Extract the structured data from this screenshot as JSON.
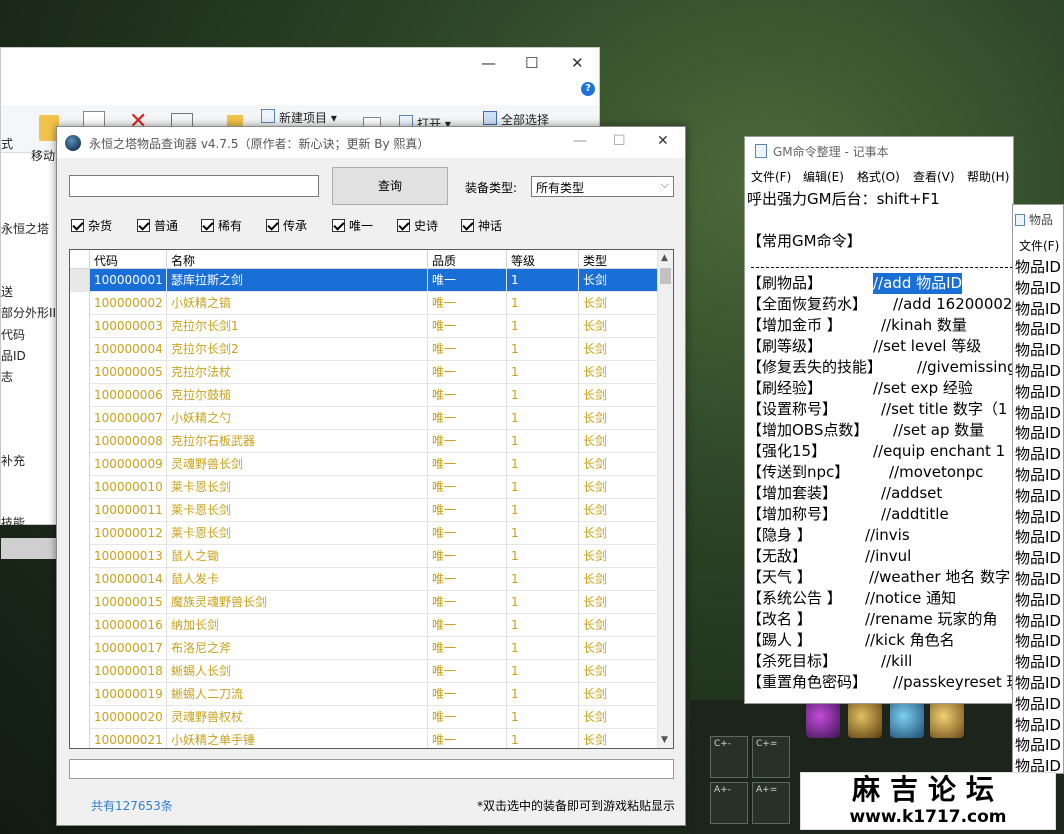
{
  "explorer": {
    "ribbon": {
      "new_item": "新建项目 ▾",
      "open": "打开 ▾",
      "select_all": "全部选择",
      "move": "移动",
      "partial_left": "式"
    },
    "nav_items": [
      "永恒之塔",
      "送",
      "部分外形II",
      "代码",
      "品ID",
      "志",
      "补充",
      "技能"
    ]
  },
  "query": {
    "title": "永恒之塔物品查询器 v4.7.5（原作者：新心诀；更新 By 熙真）",
    "search_value": "",
    "search_button": "查询",
    "type_label": "装备类型:",
    "type_value": "所有类型",
    "checkboxes": [
      "杂货",
      "普通",
      "稀有",
      "传承",
      "唯一",
      "史诗",
      "神话"
    ],
    "columns": [
      "代码",
      "名称",
      "品质",
      "等级",
      "类型"
    ],
    "rows": [
      [
        "100000001",
        "瑟库拉斯之剑",
        "唯一",
        "1",
        "长剑"
      ],
      [
        "100000002",
        "小妖精之镐",
        "唯一",
        "1",
        "长剑"
      ],
      [
        "100000003",
        "克拉尔长剑1",
        "唯一",
        "1",
        "长剑"
      ],
      [
        "100000004",
        "克拉尔长剑2",
        "唯一",
        "1",
        "长剑"
      ],
      [
        "100000005",
        "克拉尔法杖",
        "唯一",
        "1",
        "长剑"
      ],
      [
        "100000006",
        "克拉尔鼓槌",
        "唯一",
        "1",
        "长剑"
      ],
      [
        "100000007",
        "小妖精之勺",
        "唯一",
        "1",
        "长剑"
      ],
      [
        "100000008",
        "克拉尔石板武器",
        "唯一",
        "1",
        "长剑"
      ],
      [
        "100000009",
        "灵魂野兽长剑",
        "唯一",
        "1",
        "长剑"
      ],
      [
        "100000010",
        "莱卡恩长剑",
        "唯一",
        "1",
        "长剑"
      ],
      [
        "100000011",
        "莱卡恩长剑",
        "唯一",
        "1",
        "长剑"
      ],
      [
        "100000012",
        "莱卡恩长剑",
        "唯一",
        "1",
        "长剑"
      ],
      [
        "100000013",
        "鼠人之锄",
        "唯一",
        "1",
        "长剑"
      ],
      [
        "100000014",
        "鼠人发卡",
        "唯一",
        "1",
        "长剑"
      ],
      [
        "100000015",
        "魔族灵魂野兽长剑",
        "唯一",
        "1",
        "长剑"
      ],
      [
        "100000016",
        "纳加长剑",
        "唯一",
        "1",
        "长剑"
      ],
      [
        "100000017",
        "布洛尼之斧",
        "唯一",
        "1",
        "长剑"
      ],
      [
        "100000018",
        "蜥蜴人长剑",
        "唯一",
        "1",
        "长剑"
      ],
      [
        "100000019",
        "蜥蜴人二刀流",
        "唯一",
        "1",
        "长剑"
      ],
      [
        "100000020",
        "灵魂野兽权杖",
        "唯一",
        "1",
        "长剑"
      ],
      [
        "100000021",
        "小妖精之单手锤",
        "唯一",
        "1",
        "长剑"
      ]
    ],
    "status_value": "",
    "count": "共有127653条",
    "hint": "*双击选中的装备即可到游戏粘贴显示"
  },
  "notepad": {
    "title": "GM命令整理 - 记事本",
    "menu": [
      "文件(F)",
      "编辑(E)",
      "格式(O)",
      "查看(V)",
      "帮助(H)"
    ],
    "header": "呼出强力GM后台：shift+F1",
    "section": "【常用GM命令】",
    "commands": [
      {
        "k": "【刷物品】",
        "v": "//add 物品ID"
      },
      {
        "k": "【全面恢复药水】",
        "v": "//add 16200002"
      },
      {
        "k": "【增加金币 】",
        "v": "//kinah 数量"
      },
      {
        "k": "【刷等级】",
        "v": "//set level 等级"
      },
      {
        "k": "【修复丢失的技能】",
        "v": "//givemissingsk"
      },
      {
        "k": "【刷经验】",
        "v": "//set exp 经验"
      },
      {
        "k": "【设置称号】",
        "v": "//set title 数字（1"
      },
      {
        "k": "【增加OBS点数】",
        "v": "//set ap 数量"
      },
      {
        "k": "【强化15】",
        "v": "//equip enchant 1"
      },
      {
        "k": "【传送到npc】",
        "v": "//movetonpc"
      },
      {
        "k": "【增加套装】",
        "v": "//addset"
      },
      {
        "k": "【增加称号】",
        "v": "//addtitle"
      },
      {
        "k": "【隐身 】",
        "v": "//invis"
      },
      {
        "k": "【无敌】",
        "v": "//invul"
      },
      {
        "k": "【天气 】",
        "v": "//weather 地名 数字"
      },
      {
        "k": "【系统公告 】",
        "v": "//notice 通知"
      },
      {
        "k": "【改名 】",
        "v": "//rename 玩家的角"
      },
      {
        "k": "【踢人 】",
        "v": "//kick 角色名"
      },
      {
        "k": "【杀死目标】",
        "v": "//kill"
      },
      {
        "k": "【重置角色密码】",
        "v": "//passkeyreset 玩"
      }
    ]
  },
  "notepad2": {
    "title": "物品",
    "menu": "文件(F)",
    "lines": [
      "物品ID",
      "物品ID",
      "物品ID",
      "物品ID",
      "物品ID",
      "物品ID",
      "物品ID",
      "物品ID",
      "物品ID",
      "物品ID",
      "物品ID",
      "物品ID",
      "物品ID",
      "物品ID",
      "物品ID",
      "物品ID",
      "物品ID",
      "物品ID",
      "物品ID",
      "物品ID",
      "物品ID",
      "物品ID",
      "物品ID",
      "物品ID",
      "物品ID"
    ]
  },
  "game_keys": [
    "C+-",
    "C+=",
    "A+-",
    "A+="
  ],
  "watermark": {
    "cn": "麻吉论坛",
    "url": "www.k1717.com"
  },
  "colors": {
    "selection": "#1a6fd6",
    "unique_item": "#c9a21a",
    "count_text": "#2f7fd0"
  }
}
